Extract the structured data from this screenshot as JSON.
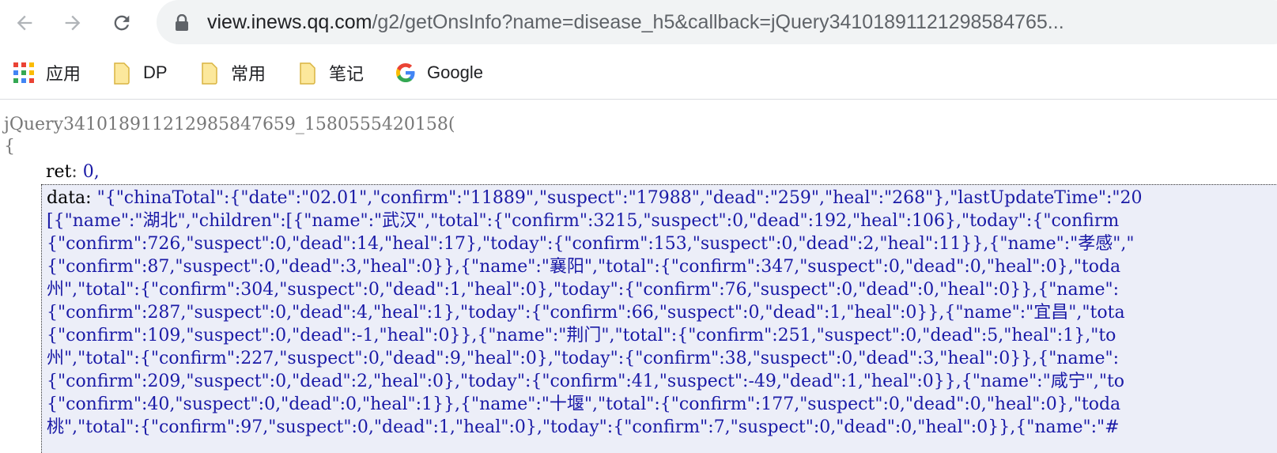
{
  "toolbar": {
    "back": "back",
    "forward": "forward",
    "reload": "reload",
    "url_host": "view.inews.qq.com",
    "url_rest": "/g2/getOnsInfo?name=disease_h5&callback=jQuery34101891121298584765..."
  },
  "bookmarks": [
    {
      "label": "应用",
      "icon": "apps-grid-icon"
    },
    {
      "label": "DP",
      "icon": "folder-icon"
    },
    {
      "label": "常用",
      "icon": "folder-icon"
    },
    {
      "label": "笔记",
      "icon": "folder-icon"
    },
    {
      "label": "Google",
      "icon": "google-icon"
    }
  ],
  "viewer": {
    "jsonp": "jQuery341018911212985847659_1580555420158(",
    "open_brace": "{",
    "ret_key": "ret",
    "ret_value": "0,",
    "data_key": "data",
    "lines": [
      " \"{\"chinaTotal\":{\"date\":\"02.01\",\"confirm\":\"11889\",\"suspect\":\"17988\",\"dead\":\"259\",\"heal\":\"268\"},\"lastUpdateTime\":\"20",
      "[{\"name\":\"湖北\",\"children\":[{\"name\":\"武汉\",\"total\":{\"confirm\":3215,\"suspect\":0,\"dead\":192,\"heal\":106},\"today\":{\"confirm",
      "{\"confirm\":726,\"suspect\":0,\"dead\":14,\"heal\":17},\"today\":{\"confirm\":153,\"suspect\":0,\"dead\":2,\"heal\":11}},{\"name\":\"孝感\",\"",
      "{\"confirm\":87,\"suspect\":0,\"dead\":3,\"heal\":0}},{\"name\":\"襄阳\",\"total\":{\"confirm\":347,\"suspect\":0,\"dead\":0,\"heal\":0},\"toda",
      "州\",\"total\":{\"confirm\":304,\"suspect\":0,\"dead\":1,\"heal\":0},\"today\":{\"confirm\":76,\"suspect\":0,\"dead\":0,\"heal\":0}},{\"name\":",
      "{\"confirm\":287,\"suspect\":0,\"dead\":4,\"heal\":1},\"today\":{\"confirm\":66,\"suspect\":0,\"dead\":1,\"heal\":0}},{\"name\":\"宜昌\",\"tota",
      "{\"confirm\":109,\"suspect\":0,\"dead\":-1,\"heal\":0}},{\"name\":\"荆门\",\"total\":{\"confirm\":251,\"suspect\":0,\"dead\":5,\"heal\":1},\"to",
      "州\",\"total\":{\"confirm\":227,\"suspect\":0,\"dead\":9,\"heal\":0},\"today\":{\"confirm\":38,\"suspect\":0,\"dead\":3,\"heal\":0}},{\"name\":",
      "{\"confirm\":209,\"suspect\":0,\"dead\":2,\"heal\":0},\"today\":{\"confirm\":41,\"suspect\":-49,\"dead\":1,\"heal\":0}},{\"name\":\"咸宁\",\"to",
      "{\"confirm\":40,\"suspect\":0,\"dead\":0,\"heal\":1}},{\"name\":\"十堰\",\"total\":{\"confirm\":177,\"suspect\":0,\"dead\":0,\"heal\":0},\"toda",
      "桃\",\"total\":{\"confirm\":97,\"suspect\":0,\"dead\":1,\"heal\":0},\"today\":{\"confirm\":7,\"suspect\":0,\"dead\":0,\"heal\":0}},{\"name\":\"#"
    ]
  },
  "colors": {
    "omnibox": "#f1f3f4",
    "data_bg": "#eceef8",
    "string_value": "#1a1aa6"
  }
}
